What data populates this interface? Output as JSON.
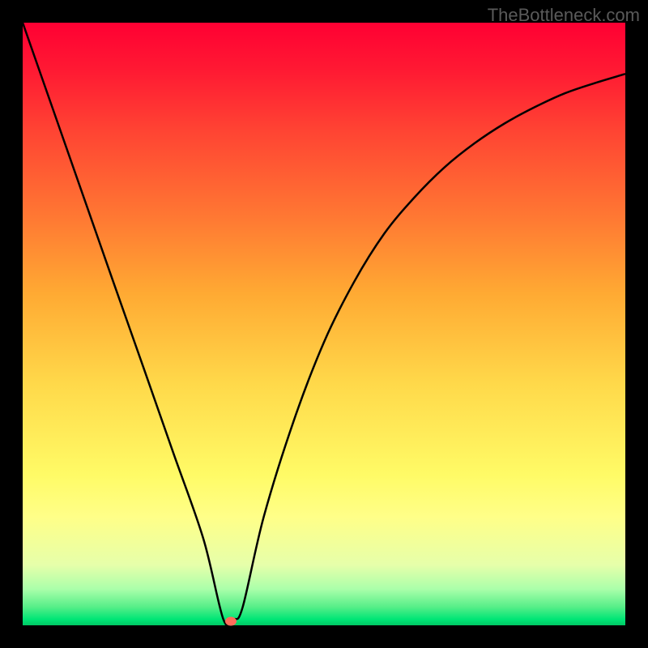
{
  "watermark": "TheBottleneck.com",
  "chart_data": {
    "type": "line",
    "title": "",
    "xlabel": "",
    "ylabel": "",
    "xlim": [
      0,
      1
    ],
    "ylim": [
      0,
      1
    ],
    "series": [
      {
        "name": "bottleneck-curve",
        "x": [
          0.0,
          0.05,
          0.1,
          0.15,
          0.2,
          0.25,
          0.3,
          0.333,
          0.35,
          0.365,
          0.4,
          0.45,
          0.5,
          0.55,
          0.6,
          0.65,
          0.7,
          0.75,
          0.8,
          0.85,
          0.9,
          0.95,
          1.0
        ],
        "y": [
          1.0,
          0.857,
          0.714,
          0.571,
          0.429,
          0.286,
          0.143,
          0.01,
          0.01,
          0.03,
          0.18,
          0.34,
          0.47,
          0.57,
          0.65,
          0.71,
          0.76,
          0.8,
          0.833,
          0.86,
          0.883,
          0.9,
          0.915
        ]
      }
    ],
    "marker": {
      "x": 0.345,
      "y": 0.007
    },
    "background_gradient": {
      "stops": [
        {
          "pos": 0.0,
          "color": "#ff0033"
        },
        {
          "pos": 0.5,
          "color": "#ffaa33"
        },
        {
          "pos": 0.8,
          "color": "#ffff66"
        },
        {
          "pos": 0.97,
          "color": "#55ee88"
        },
        {
          "pos": 1.0,
          "color": "#00c864"
        }
      ]
    }
  }
}
